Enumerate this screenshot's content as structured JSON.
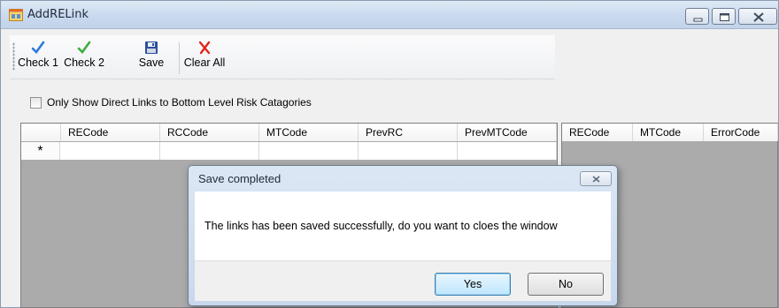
{
  "window": {
    "title": "AddRELink",
    "icon": "app-window-icon",
    "controls": [
      "minimize-icon",
      "maximize-icon",
      "close-icon"
    ]
  },
  "toolbar": {
    "check1": {
      "label": "Check 1",
      "icon": "checkmark-blue-icon"
    },
    "check2": {
      "label": "Check 2",
      "icon": "checkmark-green-icon"
    },
    "save": {
      "label": "Save",
      "icon": "floppy-disk-icon"
    },
    "clear_all": {
      "label": "Clear All",
      "icon": "red-x-icon"
    }
  },
  "filter": {
    "checkbox_label": "Only Show Direct Links to Bottom Level Risk Catagories",
    "checked": false
  },
  "links_grid": {
    "columns": [
      "RECode",
      "RCCode",
      "MTCode",
      "PrevRC",
      "PrevMTCode"
    ],
    "new_row_marker": "*"
  },
  "errors_grid": {
    "columns": [
      "RECode",
      "MTCode",
      "ErrorCode"
    ]
  },
  "dialog": {
    "title": "Save completed",
    "message": "The links has been saved successfully, do you want to cloes the window",
    "yes_label": "Yes",
    "no_label": "No"
  },
  "colors": {
    "titlebar": "#c9d9ee",
    "grid_background": "#ababab",
    "default_button": "#bee6fd"
  }
}
